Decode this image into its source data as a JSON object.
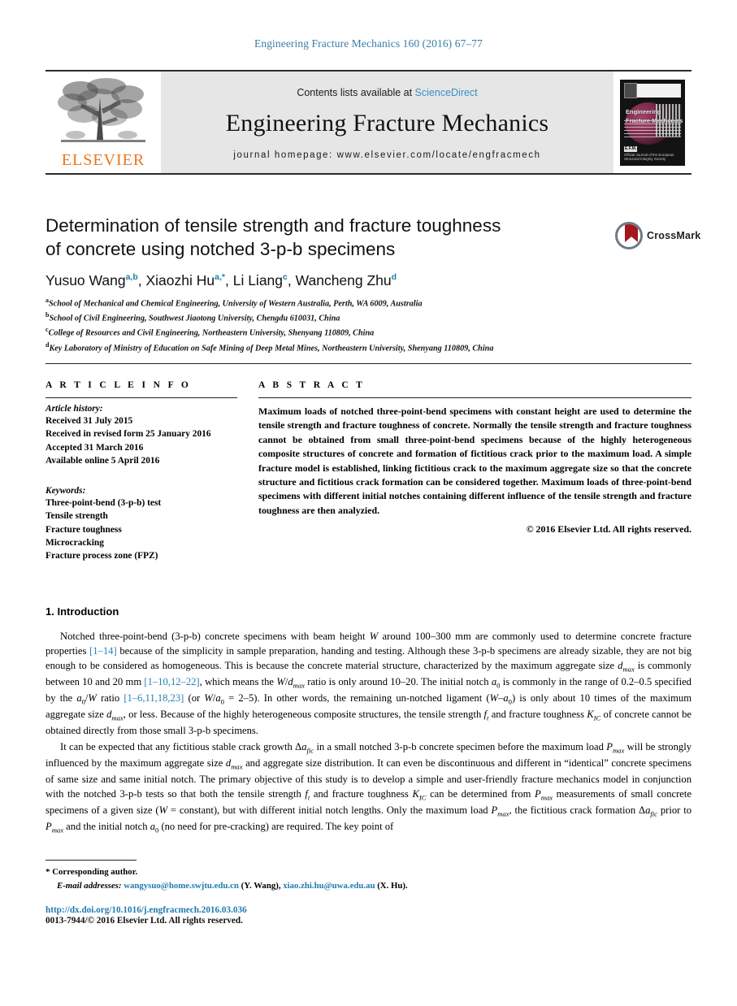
{
  "running_head": "Engineering Fracture Mechanics 160 (2016) 67–77",
  "masthead": {
    "contents_prefix": "Contents lists available at ",
    "contents_link": "ScienceDirect",
    "journal_title": "Engineering Fracture Mechanics",
    "homepage": "journal homepage: www.elsevier.com/locate/engfracmech",
    "publisher_wordmark": "ELSEVIER",
    "cover": {
      "title_line1": "Engineering",
      "title_line2": "Fracture Mechanics",
      "footer_badge": "E.F.M.",
      "footer_text": "Official Journal of the European Structural Integrity Society"
    }
  },
  "article": {
    "title_line1": "Determination of tensile strength and fracture toughness",
    "title_line2": "of concrete using notched 3-p-b specimens",
    "crossmark_label": "CrossMark",
    "authors": [
      {
        "name": "Yusuo Wang",
        "marks": "a,b"
      },
      {
        "name": "Xiaozhi Hu",
        "marks": "a,*"
      },
      {
        "name": "Li Liang",
        "marks": "c"
      },
      {
        "name": "Wancheng Zhu",
        "marks": "d"
      }
    ],
    "affiliations": [
      {
        "mark": "a",
        "text": "School of Mechanical and Chemical Engineering, University of Western Australia, Perth, WA 6009, Australia"
      },
      {
        "mark": "b",
        "text": "School of Civil Engineering, Southwest Jiaotong University, Chengdu 610031, China"
      },
      {
        "mark": "c",
        "text": "College of Resources and Civil Engineering, Northeastern University, Shenyang 110809, China"
      },
      {
        "mark": "d",
        "text": "Key Laboratory of Ministry of Education on Safe Mining of Deep Metal Mines, Northeastern University, Shenyang 110809, China"
      }
    ]
  },
  "article_info": {
    "heading": "A R T I C L E    I N F O",
    "history_heading": "Article history:",
    "history": [
      "Received 31 July 2015",
      "Received in revised form 25 January 2016",
      "Accepted 31 March 2016",
      "Available online 5 April 2016"
    ],
    "keywords_heading": "Keywords:",
    "keywords": [
      "Three-point-bend (3-p-b) test",
      "Tensile strength",
      "Fracture toughness",
      "Microcracking",
      "Fracture process zone (FPZ)"
    ]
  },
  "abstract": {
    "heading": "A B S T R A C T",
    "text": "Maximum loads of notched three-point-bend specimens with constant height are used to determine the tensile strength and fracture toughness of concrete. Normally the tensile strength and fracture toughness cannot be obtained from small three-point-bend specimens because of the highly heterogeneous composite structures of concrete and formation of fictitious crack prior to the maximum load. A simple fracture model is established, linking fictitious crack to the maximum aggregate size so that the concrete structure and fictitious crack formation can be considered together. Maximum loads of three-point-bend specimens with different initial notches containing different influence of the tensile strength and fracture toughness are then analyzied.",
    "copyright": "© 2016 Elsevier Ltd. All rights reserved."
  },
  "section": {
    "heading": "1. Introduction"
  },
  "footer": {
    "corresponding": "Corresponding author.",
    "email_label": "E-mail addresses:",
    "email1": "wangysuo@home.swjtu.edu.cn",
    "email1_who": "(Y. Wang)",
    "email2": "xiao.zhi.hu@uwa.edu.au",
    "email2_who": "(X. Hu)",
    "doi": "http://dx.doi.org/10.1016/j.engfracmech.2016.03.036",
    "issn": "0013-7944/© 2016 Elsevier Ltd. All rights reserved."
  },
  "colors": {
    "link": "#2a7fb5",
    "elsevier_orange": "#E87722",
    "crossmark_red": "#a3161c"
  }
}
